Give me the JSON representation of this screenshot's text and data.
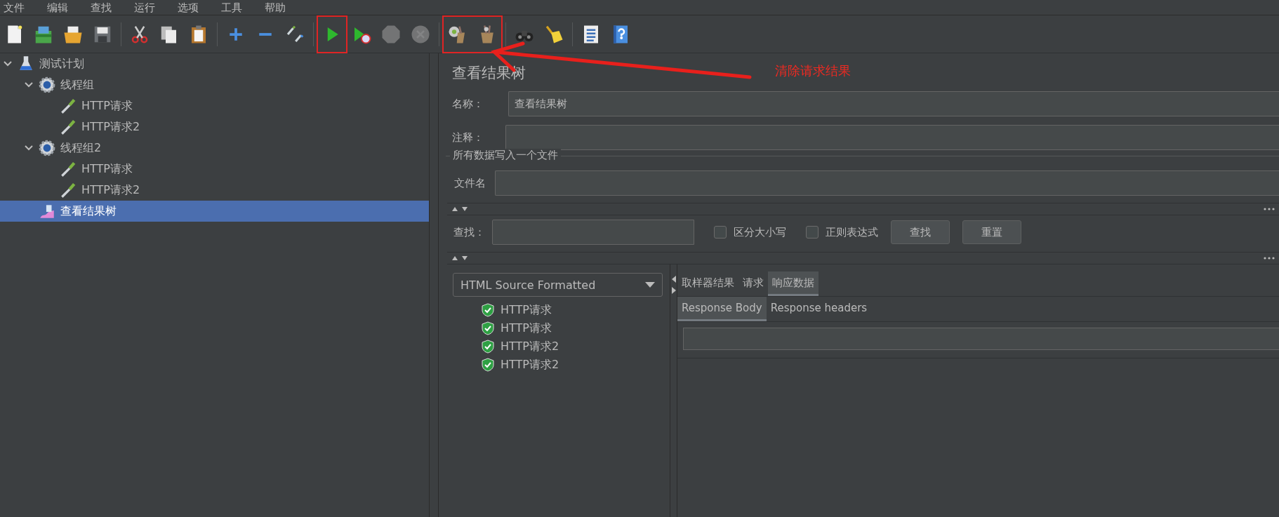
{
  "menu_bar": [
    "文件",
    "编辑",
    "查找",
    "运行",
    "选项",
    "工具",
    "帮助"
  ],
  "toolbar": [
    {
      "highlighted": false,
      "items": [
        {
          "kind": "new",
          "disabled": false
        },
        {
          "kind": "templates",
          "disabled": false
        },
        {
          "kind": "open",
          "disabled": false
        },
        {
          "kind": "save",
          "disabled": false
        }
      ]
    },
    {
      "highlighted": false,
      "items": [
        {
          "kind": "separator"
        },
        {
          "kind": "cut",
          "disabled": false
        },
        {
          "kind": "copy",
          "disabled": false
        },
        {
          "kind": "paste",
          "disabled": false
        }
      ]
    },
    {
      "highlighted": false,
      "items": [
        {
          "kind": "separator"
        },
        {
          "kind": "expand",
          "disabled": false
        },
        {
          "kind": "collapse",
          "disabled": false
        },
        {
          "kind": "toggle",
          "disabled": false
        }
      ]
    },
    {
      "highlighted": false,
      "items": [
        {
          "kind": "separator"
        }
      ]
    },
    {
      "highlighted": true,
      "items": [
        {
          "kind": "start",
          "disabled": false
        }
      ]
    },
    {
      "highlighted": false,
      "items": [
        {
          "kind": "start_no_pauses",
          "disabled": false
        },
        {
          "kind": "stop",
          "disabled": true
        },
        {
          "kind": "shutdown",
          "disabled": true
        },
        {
          "kind": "separator"
        }
      ]
    },
    {
      "highlighted": true,
      "items": [
        {
          "kind": "clear",
          "disabled": false
        },
        {
          "kind": "clear_all",
          "disabled": false
        }
      ]
    },
    {
      "highlighted": false,
      "items": [
        {
          "kind": "separator"
        },
        {
          "kind": "search",
          "disabled": false
        },
        {
          "kind": "reset_search",
          "disabled": false
        }
      ]
    },
    {
      "highlighted": false,
      "items": [
        {
          "kind": "separator"
        },
        {
          "kind": "function_helper",
          "disabled": false
        },
        {
          "kind": "help",
          "disabled": false
        }
      ]
    }
  ],
  "annotation": {
    "text": "清除请求结果"
  },
  "tree": [
    {
      "label": "测试计划",
      "kind": "test_plan",
      "expanded": true,
      "selected": false,
      "children": [
        {
          "label": "线程组",
          "kind": "thread_group",
          "expanded": true,
          "selected": false,
          "children": [
            {
              "label": "HTTP请求",
              "kind": "sampler",
              "selected": false
            },
            {
              "label": "HTTP请求2",
              "kind": "sampler",
              "selected": false
            }
          ]
        },
        {
          "label": "线程组2",
          "kind": "thread_group",
          "expanded": true,
          "selected": false,
          "children": [
            {
              "label": "HTTP请求",
              "kind": "sampler",
              "selected": false
            },
            {
              "label": "HTTP请求2",
              "kind": "sampler",
              "selected": false
            }
          ]
        },
        {
          "label": "查看结果树",
          "kind": "listener",
          "selected": true
        }
      ]
    }
  ],
  "panel": {
    "title": "查看结果树",
    "name_label": "名称：",
    "name_value": "查看结果树",
    "comment_label": "注释：",
    "file_section": {
      "legend": "所有数据写入一个文件",
      "label": "文件名"
    },
    "search": {
      "label": "查找：",
      "options": [
        {
          "label": "区分大小写",
          "checked": false
        },
        {
          "label": "正则表达式",
          "checked": false
        }
      ],
      "buttons": [
        "查找",
        "重置"
      ]
    },
    "renderer": "HTML Source Formatted",
    "results": [
      {
        "label": "HTTP请求"
      },
      {
        "label": "HTTP请求"
      },
      {
        "label": "HTTP请求2"
      },
      {
        "label": "HTTP请求2"
      }
    ],
    "tabs": [
      {
        "label": "取样器结果",
        "selected": false
      },
      {
        "label": "请求",
        "selected": false
      },
      {
        "label": "响应数据",
        "selected": true
      }
    ],
    "subtabs": [
      {
        "label": "Response Body",
        "selected": true
      },
      {
        "label": "Response headers",
        "selected": false
      }
    ]
  }
}
